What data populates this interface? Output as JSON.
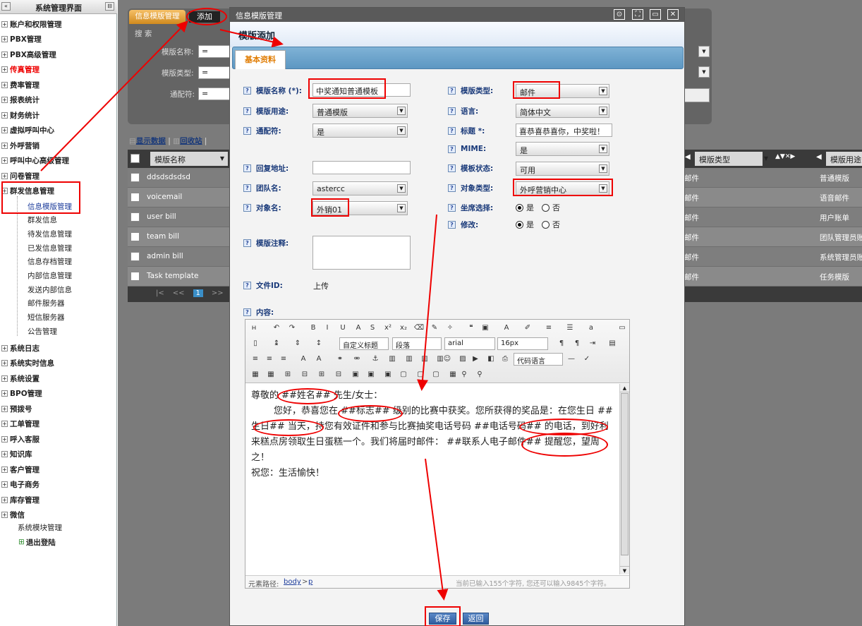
{
  "sidebar": {
    "title": "系统管理界面",
    "collapse_icon": "«",
    "pin_icon": "⊟",
    "items": [
      {
        "label": "账户和权限管理",
        "highlight": false
      },
      {
        "label": "PBX管理",
        "highlight": false
      },
      {
        "label": "PBX高级管理",
        "highlight": false
      },
      {
        "label": "传真管理",
        "highlight": true
      },
      {
        "label": "费率管理",
        "highlight": false
      },
      {
        "label": "报表统计",
        "highlight": false
      },
      {
        "label": "财务统计",
        "highlight": false
      },
      {
        "label": "虚拟呼叫中心",
        "highlight": false
      },
      {
        "label": "外呼营销",
        "highlight": false
      },
      {
        "label": "呼叫中心高级管理",
        "highlight": false
      },
      {
        "label": "问卷管理",
        "highlight": false
      },
      {
        "label": "群发信息管理",
        "highlight": false
      }
    ],
    "sub_items": [
      "信息模版管理",
      "群发信息",
      "待发信息管理",
      "已发信息管理",
      "信息存档管理",
      "内部信息管理",
      "发送内部信息",
      "邮件服务器",
      "短信服务器",
      "公告管理"
    ],
    "items2": [
      "系统日志",
      "系统实时信息",
      "系统设置",
      "BPO管理",
      "预拨号",
      "工单管理",
      "呼入客服",
      "知识库",
      "客户管理",
      "电子商务",
      "库存管理",
      "微信"
    ],
    "tail_items": [
      "系统模块管理",
      "退出登陆"
    ]
  },
  "background": {
    "tab_label": "信息模版管理",
    "add_button": "添加",
    "search_title": "搜 索",
    "search_fields": [
      "模版名称:",
      "模版类型:",
      "通配符:"
    ],
    "eq": "=",
    "toolbar_links": [
      "显示数据",
      "回收站"
    ],
    "col_template_name": "模版名称",
    "col_template_type": "模版类型",
    "col_template_use": "模版用途",
    "rows": [
      {
        "name": "ddsdsdsdsd",
        "type": "邮件",
        "use": "普通模版"
      },
      {
        "name": "voicemail",
        "type": "邮件",
        "use": "语音邮件"
      },
      {
        "name": "user bill",
        "type": "邮件",
        "use": "用户账单"
      },
      {
        "name": "team bill",
        "type": "邮件",
        "use": "团队管理员账"
      },
      {
        "name": "admin bill",
        "type": "邮件",
        "use": "系统管理员账"
      },
      {
        "name": "Task template",
        "type": "邮件",
        "use": "任务模版"
      }
    ],
    "pager": [
      "|<",
      "<<",
      "1",
      ">>",
      ">|"
    ]
  },
  "modal": {
    "window_title": "信息模版管理",
    "heading": "模版添加",
    "tab": "基本资料",
    "left_fields": {
      "name_label": "模版名称 (*):",
      "name_value": "中奖通知普通模板",
      "use_label": "模版用途:",
      "use_value": "普通模版",
      "wildcard_label": "通配符:",
      "wildcard_value": "是",
      "reply_label": "回复地址:",
      "reply_value": "",
      "team_label": "团队名:",
      "team_value": "astercc",
      "obj_name_label": "对象名:",
      "obj_name_value": "外销01",
      "note_label": "模版注释:",
      "file_label": "文件ID:",
      "file_value": "上传",
      "content_label": "内容:"
    },
    "right_fields": {
      "type_label": "模版类型:",
      "type_value": "邮件",
      "lang_label": "语言:",
      "lang_value": "简体中文",
      "subject_label": "标题 *:",
      "subject_value": "喜恭喜恭喜你，中奖啦！",
      "mime_label": "MIME:",
      "mime_value": "是",
      "status_label": "模板状态:",
      "status_value": "可用",
      "objtype_label": "对象类型:",
      "objtype_value": "外呼营销中心",
      "seat_label": "坐席选择:",
      "edit_label": "修改:",
      "yes": "是",
      "no": "否"
    },
    "editor": {
      "toolbar_selects": {
        "heading": "自定义标题",
        "paragraph": "段落",
        "font": "arial",
        "size": "16px",
        "code": "代码语言"
      },
      "line1": "尊敬的 ##姓名## 先生/女士：",
      "line2": "您好，恭喜您在 ##标志## 级别的比赛中获奖。您所获得的奖品是：在您生日 ##生日## 当天，持您有效证件和参与比赛抽奖电话号码 ##电话号码## 的电话，到好利来糕点房领取生日蛋糕一个。我们将届时邮件： ##联系人电子邮件## 提醒您，望周之！",
      "line3": "祝您：生活愉快！",
      "path_label": "元素路径:",
      "path_body": "body",
      "path_sep": ">",
      "path_p": "p",
      "counter": "当前已输入155个字符, 您还可以输入9845个字符。"
    },
    "save_button": "保存",
    "back_button": "返回"
  },
  "colors": {
    "annotation": "#e00000",
    "accent": "#e07b00",
    "link": "#1a3a7a"
  }
}
